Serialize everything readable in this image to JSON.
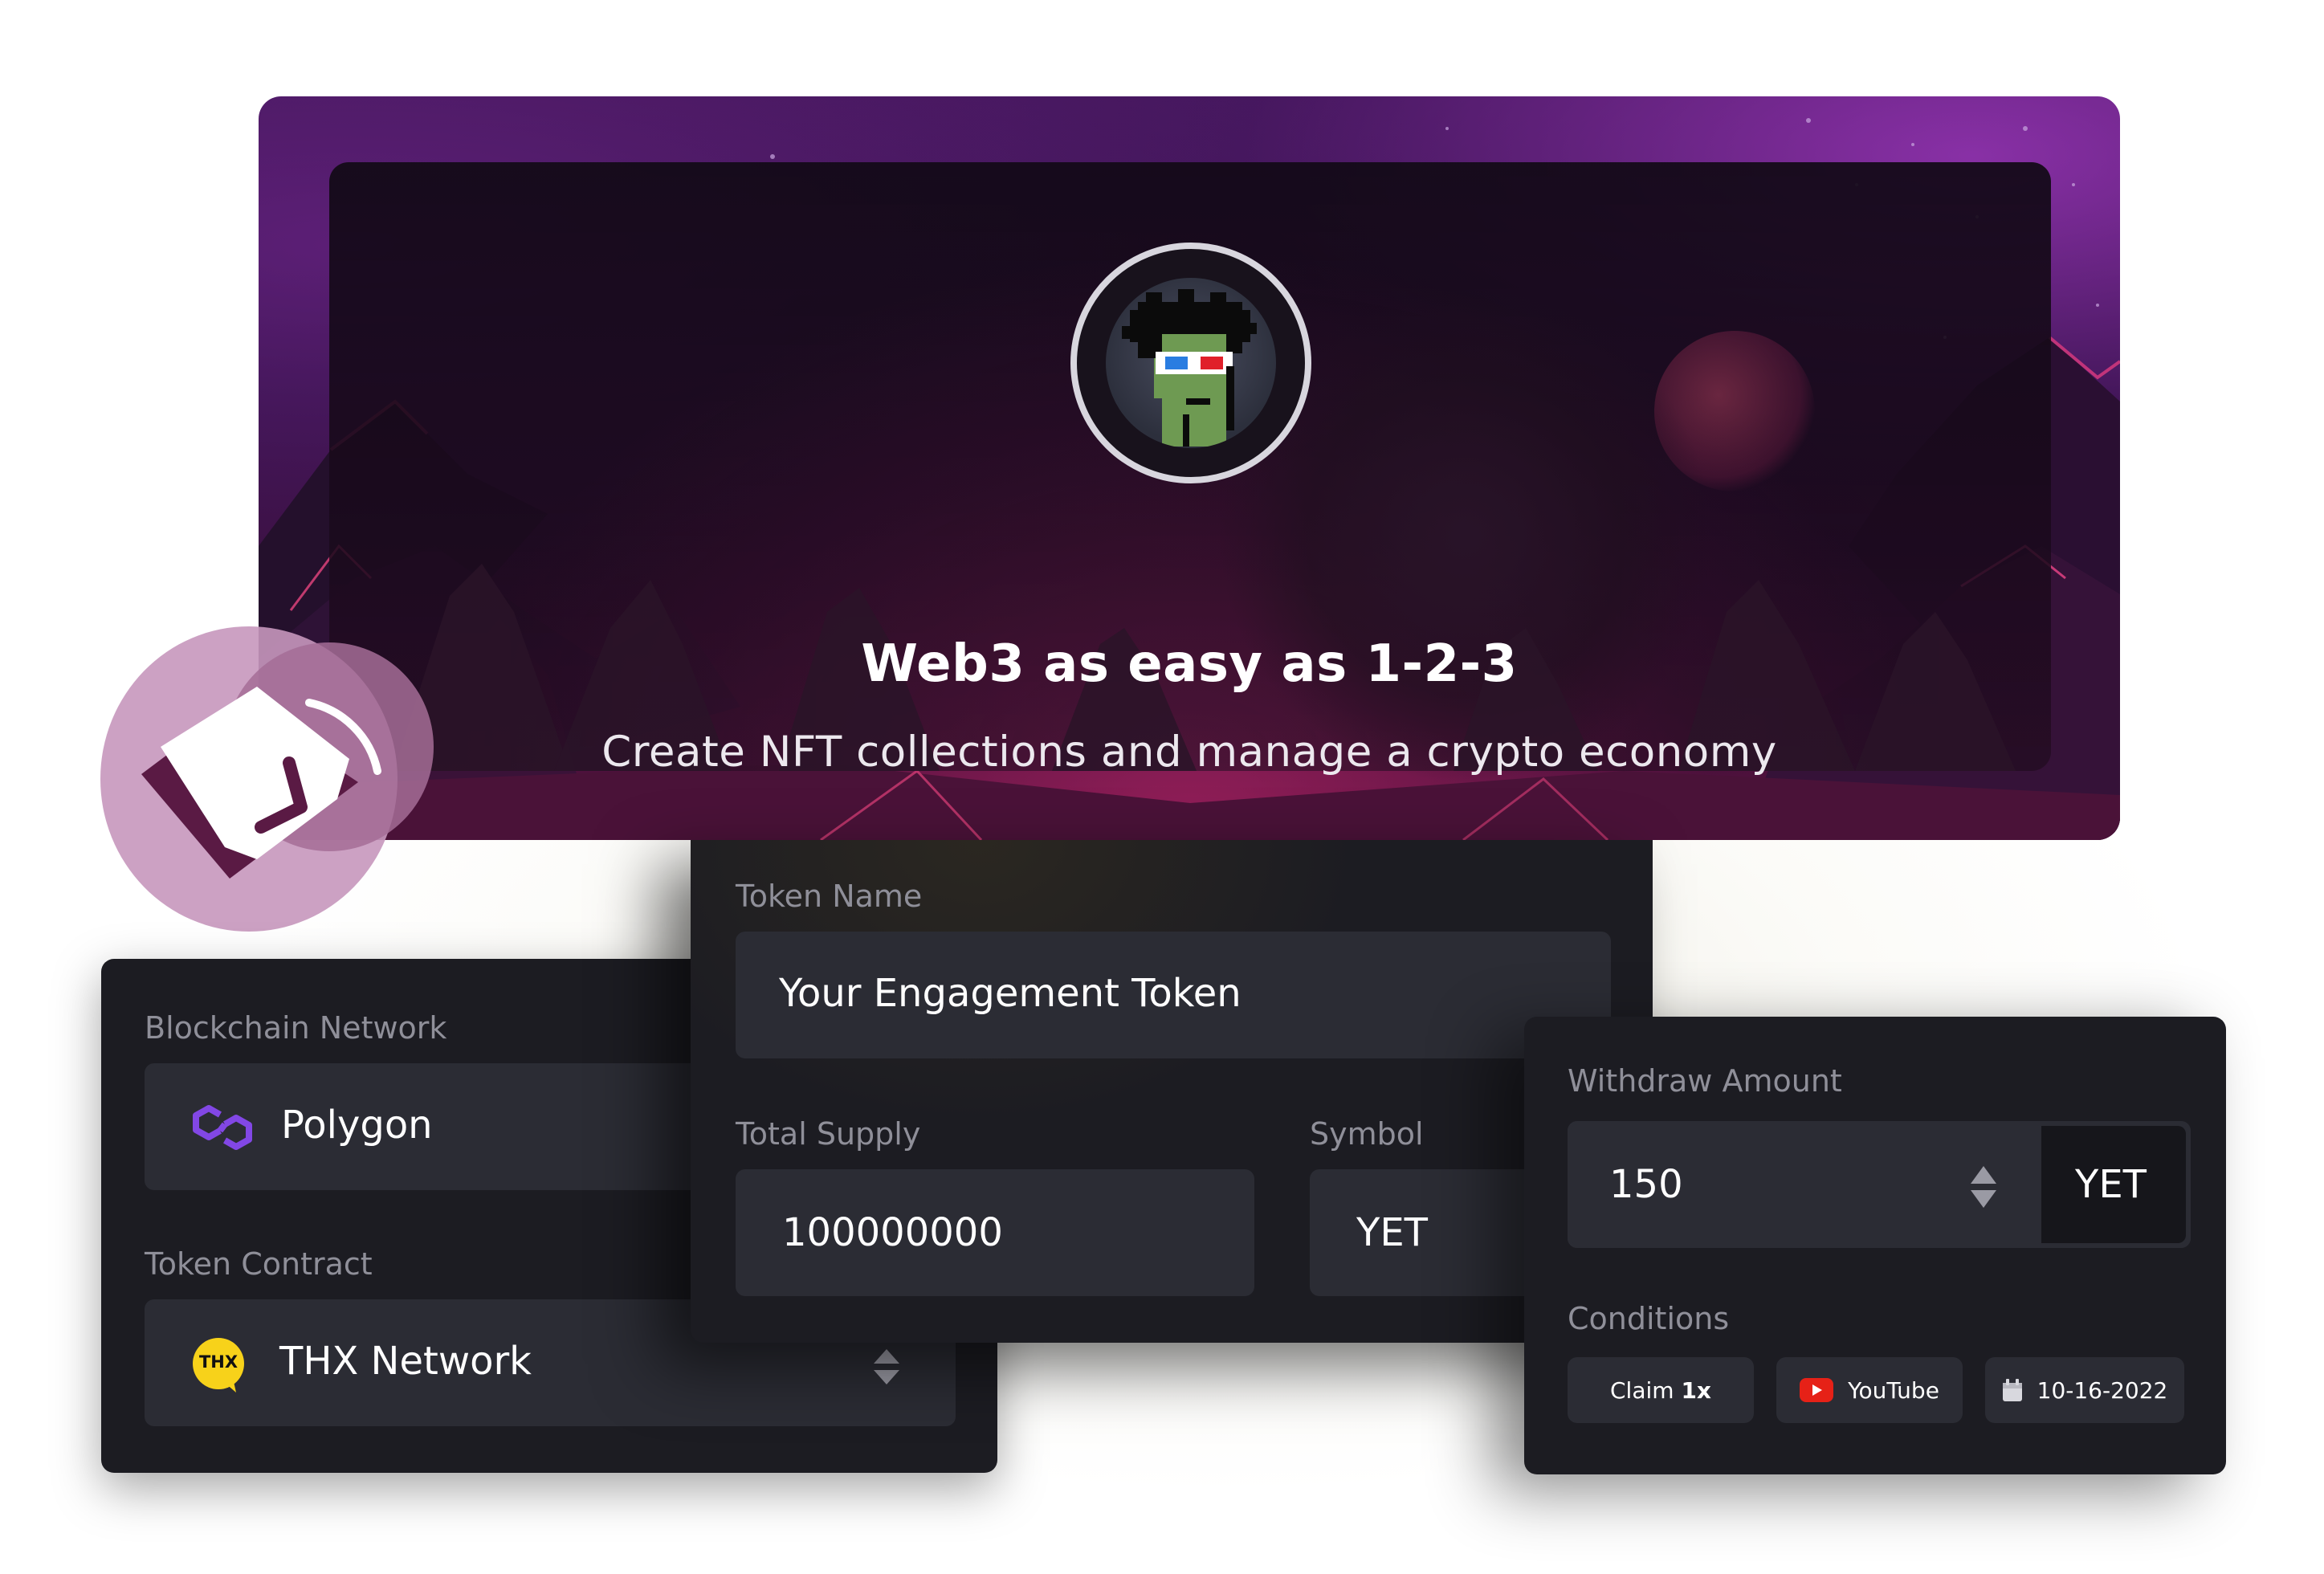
{
  "hero": {
    "title": "Web3 as easy as 1-2-3",
    "subtitle": "Create NFT collections and manage a crypto economy"
  },
  "blockchain_card": {
    "network_label": "Blockchain Network",
    "network_value": "Polygon",
    "contract_label": "Token Contract",
    "contract_value": "THX Network",
    "contract_badge": "THX"
  },
  "token_card": {
    "name_label": "Token Name",
    "name_value": "Your Engagement Token",
    "supply_label": "Total Supply",
    "supply_value": "100000000",
    "symbol_label": "Symbol",
    "symbol_value": "YET"
  },
  "withdraw_card": {
    "amount_label": "Withdraw Amount",
    "amount_value": "150",
    "amount_unit": "YET",
    "conditions_label": "Conditions",
    "chips": {
      "claim_prefix": "Claim",
      "claim_count": "1x",
      "platform": "YouTube",
      "date": "10-16-2022"
    }
  },
  "colors": {
    "card_bg": "#1c1c22",
    "field_bg": "#2b2c34",
    "label": "#8f8f99",
    "polygon_purple": "#8247e5",
    "thx_yellow": "#f7d21a",
    "youtube_red": "#e62117",
    "logo_pink": "#c28fb5",
    "logo_dark": "#5a1a44"
  },
  "icons": [
    "polygon-icon",
    "thx-logo-icon",
    "stepper-icon",
    "youtube-icon",
    "calendar-icon",
    "thx-brand-logo-icon",
    "avatar-punk-icon"
  ]
}
